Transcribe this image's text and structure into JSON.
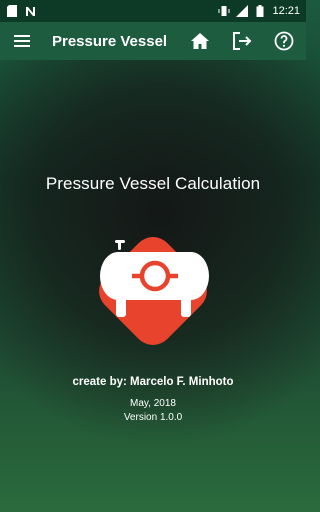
{
  "status_bar": {
    "time": "12:21",
    "icons": [
      "sd-card-icon",
      "n-notification-icon",
      "vibrate-icon",
      "signal-icon",
      "battery-icon"
    ]
  },
  "toolbar": {
    "title": "Pressure Vessel",
    "icons": [
      "menu-icon",
      "home-icon",
      "exit-icon",
      "help-icon"
    ],
    "background": "#1e5c40"
  },
  "main": {
    "headline": "Pressure Vessel Calculation",
    "logo_color": "#e8432d",
    "author_line": "create by: Marcelo F. Minhoto",
    "date": "May, 2018",
    "version": "Version 1.0.0"
  }
}
